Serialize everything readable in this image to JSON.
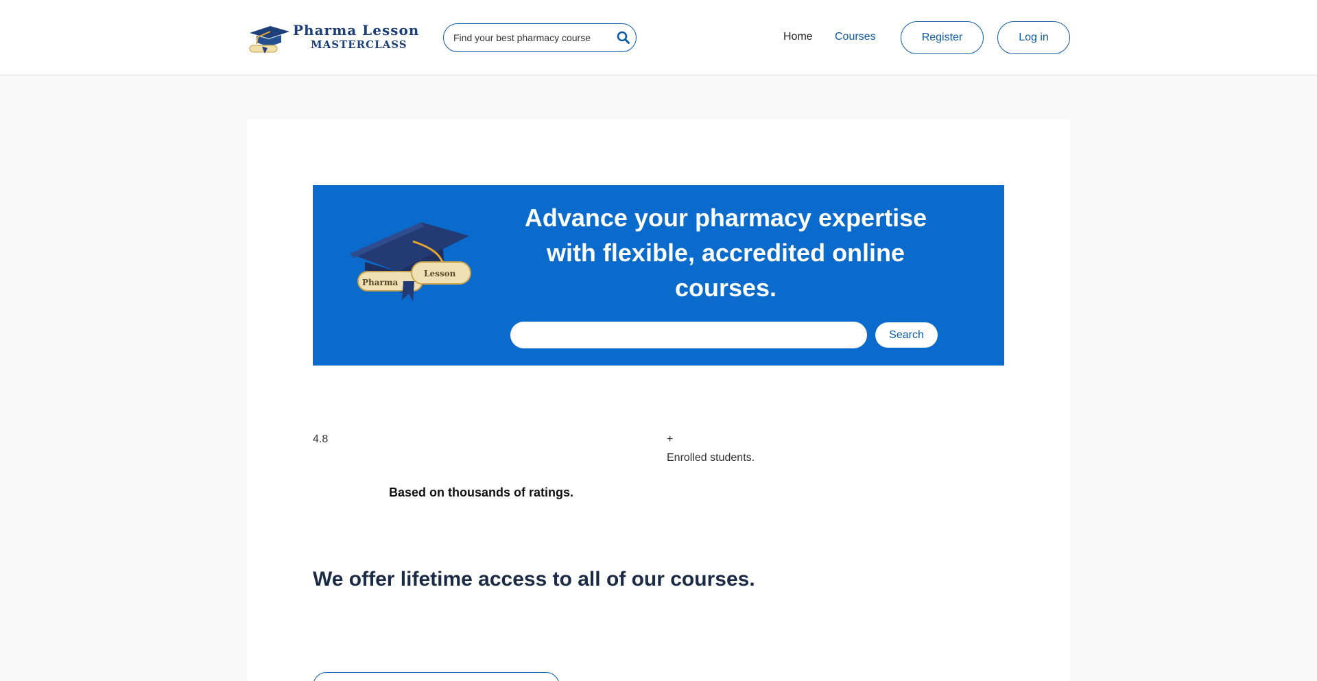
{
  "brand": {
    "name_line1": "Pharma Lesson",
    "name_line2": "MASTERCLASS"
  },
  "header": {
    "search_placeholder": "Find your best pharmacy course",
    "nav": {
      "home": "Home",
      "courses": "Courses"
    },
    "register_label": "Register",
    "login_label": "Log in"
  },
  "hero": {
    "title": "Advance your pharmacy expertise with flexible, accredited online courses.",
    "search_value": "",
    "search_button": "Search",
    "cap_label_left": "Pharma",
    "cap_label_right": "Lesson"
  },
  "stats": {
    "rating_value": "4.8",
    "stars": "",
    "ratings_note": "Based on thousands of ratings.",
    "students_prefix": "+",
    "students_label": "Enrolled students."
  },
  "main": {
    "lifetime_heading": "We offer lifetime access to all of our courses."
  },
  "colors": {
    "brand_blue": "#0b5aa8",
    "hero_blue": "#0a6bcd",
    "navy": "#1d3f7a",
    "gold": "#e5a530"
  }
}
